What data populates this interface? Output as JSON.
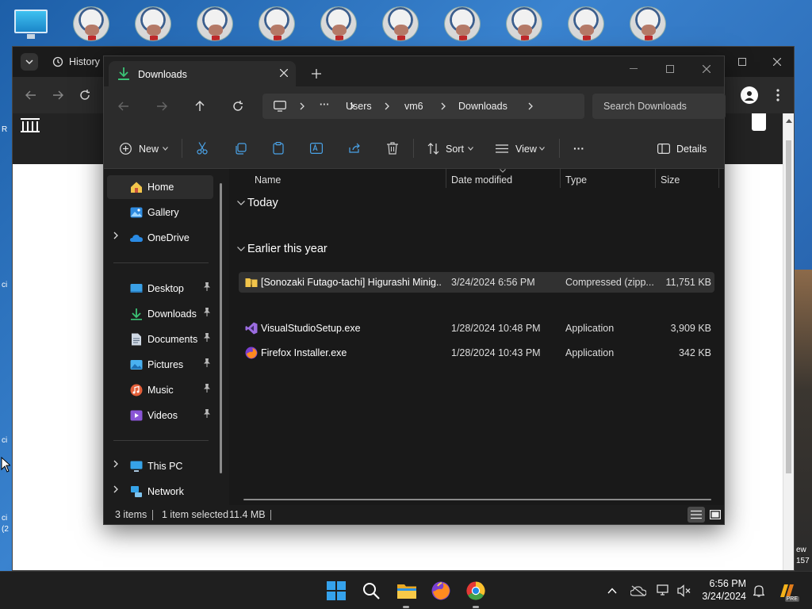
{
  "desktop": {
    "side_labels": [
      "R",
      "ci",
      "ci",
      "ci",
      "(2"
    ],
    "right_labels": [
      "ew",
      "157"
    ]
  },
  "browser": {
    "history_label": "History"
  },
  "explorer": {
    "tab_title": "Downloads",
    "breadcrumb": [
      "Users",
      "vm6",
      "Downloads"
    ],
    "breadcrumb_more": "···",
    "search_placeholder": "Search Downloads",
    "toolbar": {
      "new_label": "New",
      "sort_label": "Sort",
      "view_label": "View",
      "more_label": "···",
      "details_label": "Details"
    },
    "sidebar": {
      "top": [
        {
          "label": "Home",
          "icon": "home-icon",
          "selected": true
        },
        {
          "label": "Gallery",
          "icon": "gallery-icon"
        },
        {
          "label": "OneDrive",
          "icon": "onedrive-icon",
          "expandable": true
        }
      ],
      "pinned": [
        {
          "label": "Desktop",
          "icon": "desktop-icon"
        },
        {
          "label": "Downloads",
          "icon": "download-icon"
        },
        {
          "label": "Documents",
          "icon": "documents-icon"
        },
        {
          "label": "Pictures",
          "icon": "pictures-icon"
        },
        {
          "label": "Music",
          "icon": "music-icon"
        },
        {
          "label": "Videos",
          "icon": "videos-icon"
        }
      ],
      "bottom": [
        {
          "label": "This PC",
          "icon": "pc-icon"
        },
        {
          "label": "Network",
          "icon": "network-icon"
        }
      ]
    },
    "columns": [
      "Name",
      "Date modified",
      "Type",
      "Size"
    ],
    "groups": [
      {
        "title": "Today",
        "files": [
          {
            "name": "[Sonozaki Futago-tachi] Higurashi Minig...",
            "date": "3/24/2024 6:56 PM",
            "type": "Compressed (zipp...",
            "size": "11,751 KB",
            "icon": "zip-folder-icon",
            "selected": true
          }
        ]
      },
      {
        "title": "Earlier this year",
        "files": [
          {
            "name": "VisualStudioSetup.exe",
            "date": "1/28/2024 10:48 PM",
            "type": "Application",
            "size": "3,909 KB",
            "icon": "visual-studio-icon"
          },
          {
            "name": "Firefox Installer.exe",
            "date": "1/28/2024 10:43 PM",
            "type": "Application",
            "size": "342 KB",
            "icon": "firefox-icon"
          }
        ]
      }
    ],
    "status": {
      "items": "3 items",
      "selected": "1 item selected",
      "size": "11.4 MB"
    }
  },
  "taskbar": {
    "time": "6:56 PM",
    "date": "3/24/2024",
    "badge": "PRE"
  },
  "colors": {
    "accent": "#0a84ff",
    "download_green": "#3bc275",
    "folder_yellow": "#f2c54b"
  }
}
